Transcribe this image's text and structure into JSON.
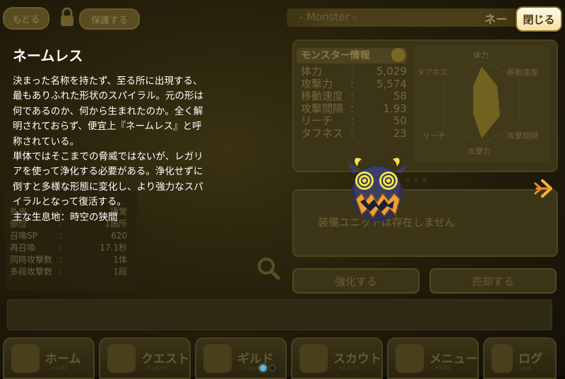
{
  "top_bar": {
    "back_label": "もどる",
    "protect_label": "保護する",
    "close_label": "閉じる"
  },
  "monster_header": {
    "section_label": "- Monster -",
    "name_fragment": "ネー"
  },
  "info_panel": {
    "title": "モンスター情報",
    "stats": [
      {
        "key": "体力",
        "colon": ":",
        "value": "5,029"
      },
      {
        "key": "攻撃力",
        "colon": ":",
        "value": "5,574"
      },
      {
        "key": "移動速度",
        "colon": ":",
        "value": "58"
      },
      {
        "key": "攻撃間隔",
        "colon": ":",
        "value": "1.93"
      },
      {
        "key": "リーチ",
        "colon": ":",
        "value": "50"
      },
      {
        "key": "タフネス",
        "colon": ":",
        "value": "23"
      }
    ],
    "radar_labels": {
      "top": "体力",
      "top_left": "タフネス",
      "top_right": "移動速度",
      "bottom_left": "リーチ",
      "bottom_right": "攻撃間隔",
      "bottom": "攻撃力"
    }
  },
  "equip": {
    "message": "装備ユニットは存在しません"
  },
  "actions": {
    "enhance_label": "強化する",
    "sell_label": "売却する"
  },
  "left_list": {
    "rows": [
      {
        "key": "外皮",
        "colon": ":",
        "value": "通常"
      },
      {
        "key": "部位",
        "colon": ":",
        "value": "1箇所"
      },
      {
        "key": "召喚SP",
        "colon": ":",
        "value": "620"
      },
      {
        "key": "再召喚",
        "colon": ":",
        "value": "17.1秒"
      },
      {
        "key": "同時攻撃数",
        "colon": ":",
        "value": "1体"
      },
      {
        "key": "多段攻撃数",
        "colon": ":",
        "value": "1段"
      }
    ]
  },
  "description": {
    "title": "ネームレス",
    "lines": [
      "決まった名称を持たず、至る所に出現する、",
      "最もありふれた形状のスパイラル。元の形は",
      "何であるのか、何から生まれたのか。全く解",
      "明されておらず、便宜上『ネームレス』と呼",
      "称されている。",
      "単体ではそこまでの脅威ではないが、レガリ",
      "アを使って浄化する必要がある。浄化せずに",
      "倒すと多様な形態に変化し、より強力なスパ",
      "イラルとなって復活する。",
      "主な生息地：時空の狭間"
    ]
  },
  "bottom_nav": [
    {
      "label": "ホーム",
      "sub": "HOME"
    },
    {
      "label": "クエスト",
      "sub": "QUEST"
    },
    {
      "label": "ギルド",
      "sub": "GUILD"
    },
    {
      "label": "スカウト",
      "sub": "SCOUT"
    },
    {
      "label": "メニュー",
      "sub": "MENU"
    },
    {
      "label": "ログ",
      "sub": "LOG"
    }
  ],
  "colors": {
    "accent_gold": "#f3e0a8",
    "arrow_orange": "#f08a1c"
  }
}
